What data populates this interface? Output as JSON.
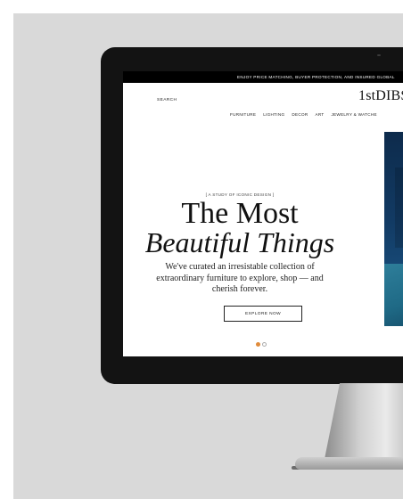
{
  "promo_bar": {
    "text": "ENJOY PRICE MATCHING, BUYER PROTECTION, AND INSURED GLOBAL"
  },
  "header": {
    "search_label": "SEARCH",
    "logo": "1stDIBS",
    "nav": [
      "FURNITURE",
      "LIGHTING",
      "DECOR",
      "ART",
      "JEWELRY & WATCHE"
    ]
  },
  "hero": {
    "kicker": "[ A STUDY OF ICONIC DESIGN ]",
    "headline_line1": "The Most",
    "headline_line2": "Beautiful Things",
    "blurb": "We've curated an irresistable collection of extraordinary furniture to explore, shop — and cherish forever.",
    "cta_label": "EXPLORE NOW",
    "carousel": {
      "active_index": 0,
      "total": 2
    }
  },
  "colors": {
    "accent_dot": "#e08b3b",
    "promo_bg": "#000000"
  }
}
